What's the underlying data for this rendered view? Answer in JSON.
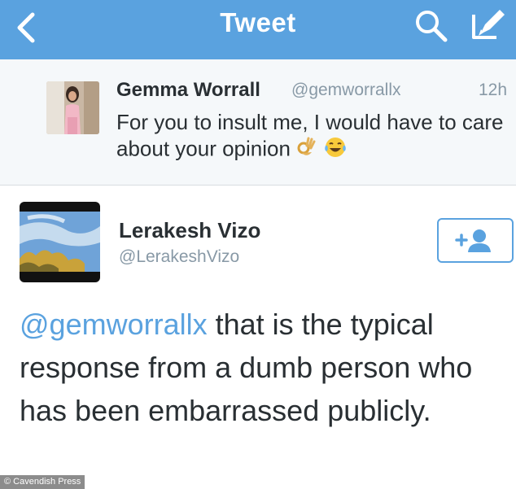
{
  "navbar": {
    "title": "Tweet",
    "back_icon": "chevron-left-icon",
    "search_icon": "search-icon",
    "compose_icon": "compose-icon",
    "background": "#5aa2df"
  },
  "parent_tweet": {
    "name": "Gemma Worrall",
    "handle": "@gemworrallx",
    "time": "12h",
    "text": "For you to insult me, I would have to care about your opinion",
    "emojis": [
      "ok-hand-icon",
      "tears-of-joy-icon"
    ]
  },
  "main_tweet": {
    "name": "Lerakesh Vizo",
    "handle": "@LerakeshVizo",
    "mention": "@gemworrallx",
    "text": " that is the typical response from a dumb person who has been embarrassed publicly.",
    "follow_icon": "add-user-icon",
    "accent": "#5aa2df"
  },
  "watermark": "© Cavendish Press"
}
